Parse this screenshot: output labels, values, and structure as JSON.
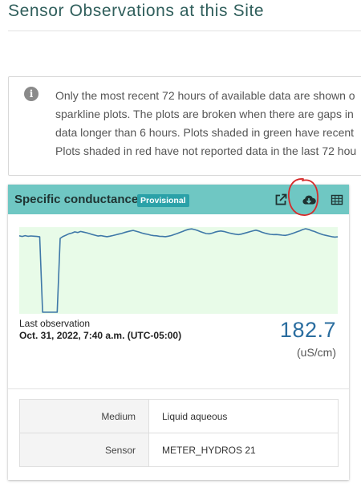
{
  "page": {
    "title": "Sensor Observations at this Site"
  },
  "info": {
    "lines": [
      "Only the most recent 72 hours of available data are shown o",
      "sparkline plots. The plots are broken when there are gaps in",
      "data longer than 6 hours. Plots shaded in green have recent",
      "Plots shaded in red have not reported data in the last 72 hou"
    ]
  },
  "card": {
    "title": "Specific conductance",
    "badge": "Provisional",
    "header_color": "#6fc7c3",
    "actions": [
      {
        "icon": "external-link-icon"
      },
      {
        "icon": "cloud-download-icon"
      },
      {
        "icon": "table-icon"
      }
    ],
    "sparkline": {
      "shading": "green",
      "fill_color": "#e8fbe8",
      "line_color": "#3f78a8",
      "values": [
        183.5,
        183.0,
        183.6,
        183.1,
        183.4,
        183.2,
        183.0,
        182.7,
        125.0,
        125.0,
        125.0,
        125.0,
        125.0,
        125.0,
        181.5,
        183.0,
        184.0,
        185.0,
        185.6,
        186.5,
        186.0,
        186.8,
        186.3,
        185.8,
        185.2,
        184.5,
        183.9,
        183.3,
        183.6,
        183.2,
        182.8,
        183.2,
        183.7,
        184.2,
        184.8,
        185.3,
        186.0,
        186.6,
        187.2,
        187.6,
        187.0,
        186.4,
        185.6,
        185.0,
        184.6,
        184.0,
        183.6,
        183.5,
        183.1,
        183.0,
        182.8,
        183.2,
        183.7,
        184.5,
        185.2,
        186.1,
        186.9,
        187.8,
        188.5,
        188.8,
        188.3,
        187.6,
        186.7,
        185.9,
        185.2,
        185.0,
        185.5,
        186.3,
        186.9,
        187.2,
        186.8,
        186.2,
        185.6,
        185.1,
        184.7,
        184.4,
        184.8,
        185.4,
        186.0,
        186.7,
        187.3,
        187.8,
        187.2,
        186.3,
        185.6,
        185.0,
        184.6,
        184.4,
        184.5,
        184.2,
        184.0,
        183.8,
        184.2,
        184.9,
        185.7,
        186.5,
        187.3,
        188.3,
        188.9,
        188.4,
        187.5,
        186.8,
        185.9,
        185.1,
        184.3,
        183.8,
        183.3,
        182.8,
        182.5,
        182.7
      ]
    },
    "last_observation_label": "Last observation",
    "last_observation_time": "Oct. 31, 2022, 7:40 a.m. (UTC-05:00)",
    "value": "182.7",
    "unit": "(uS/cm)",
    "table": [
      {
        "key": "Medium",
        "value": "Liquid aqueous"
      },
      {
        "key": "Sensor",
        "value": "METER_HYDROS 21"
      }
    ]
  }
}
